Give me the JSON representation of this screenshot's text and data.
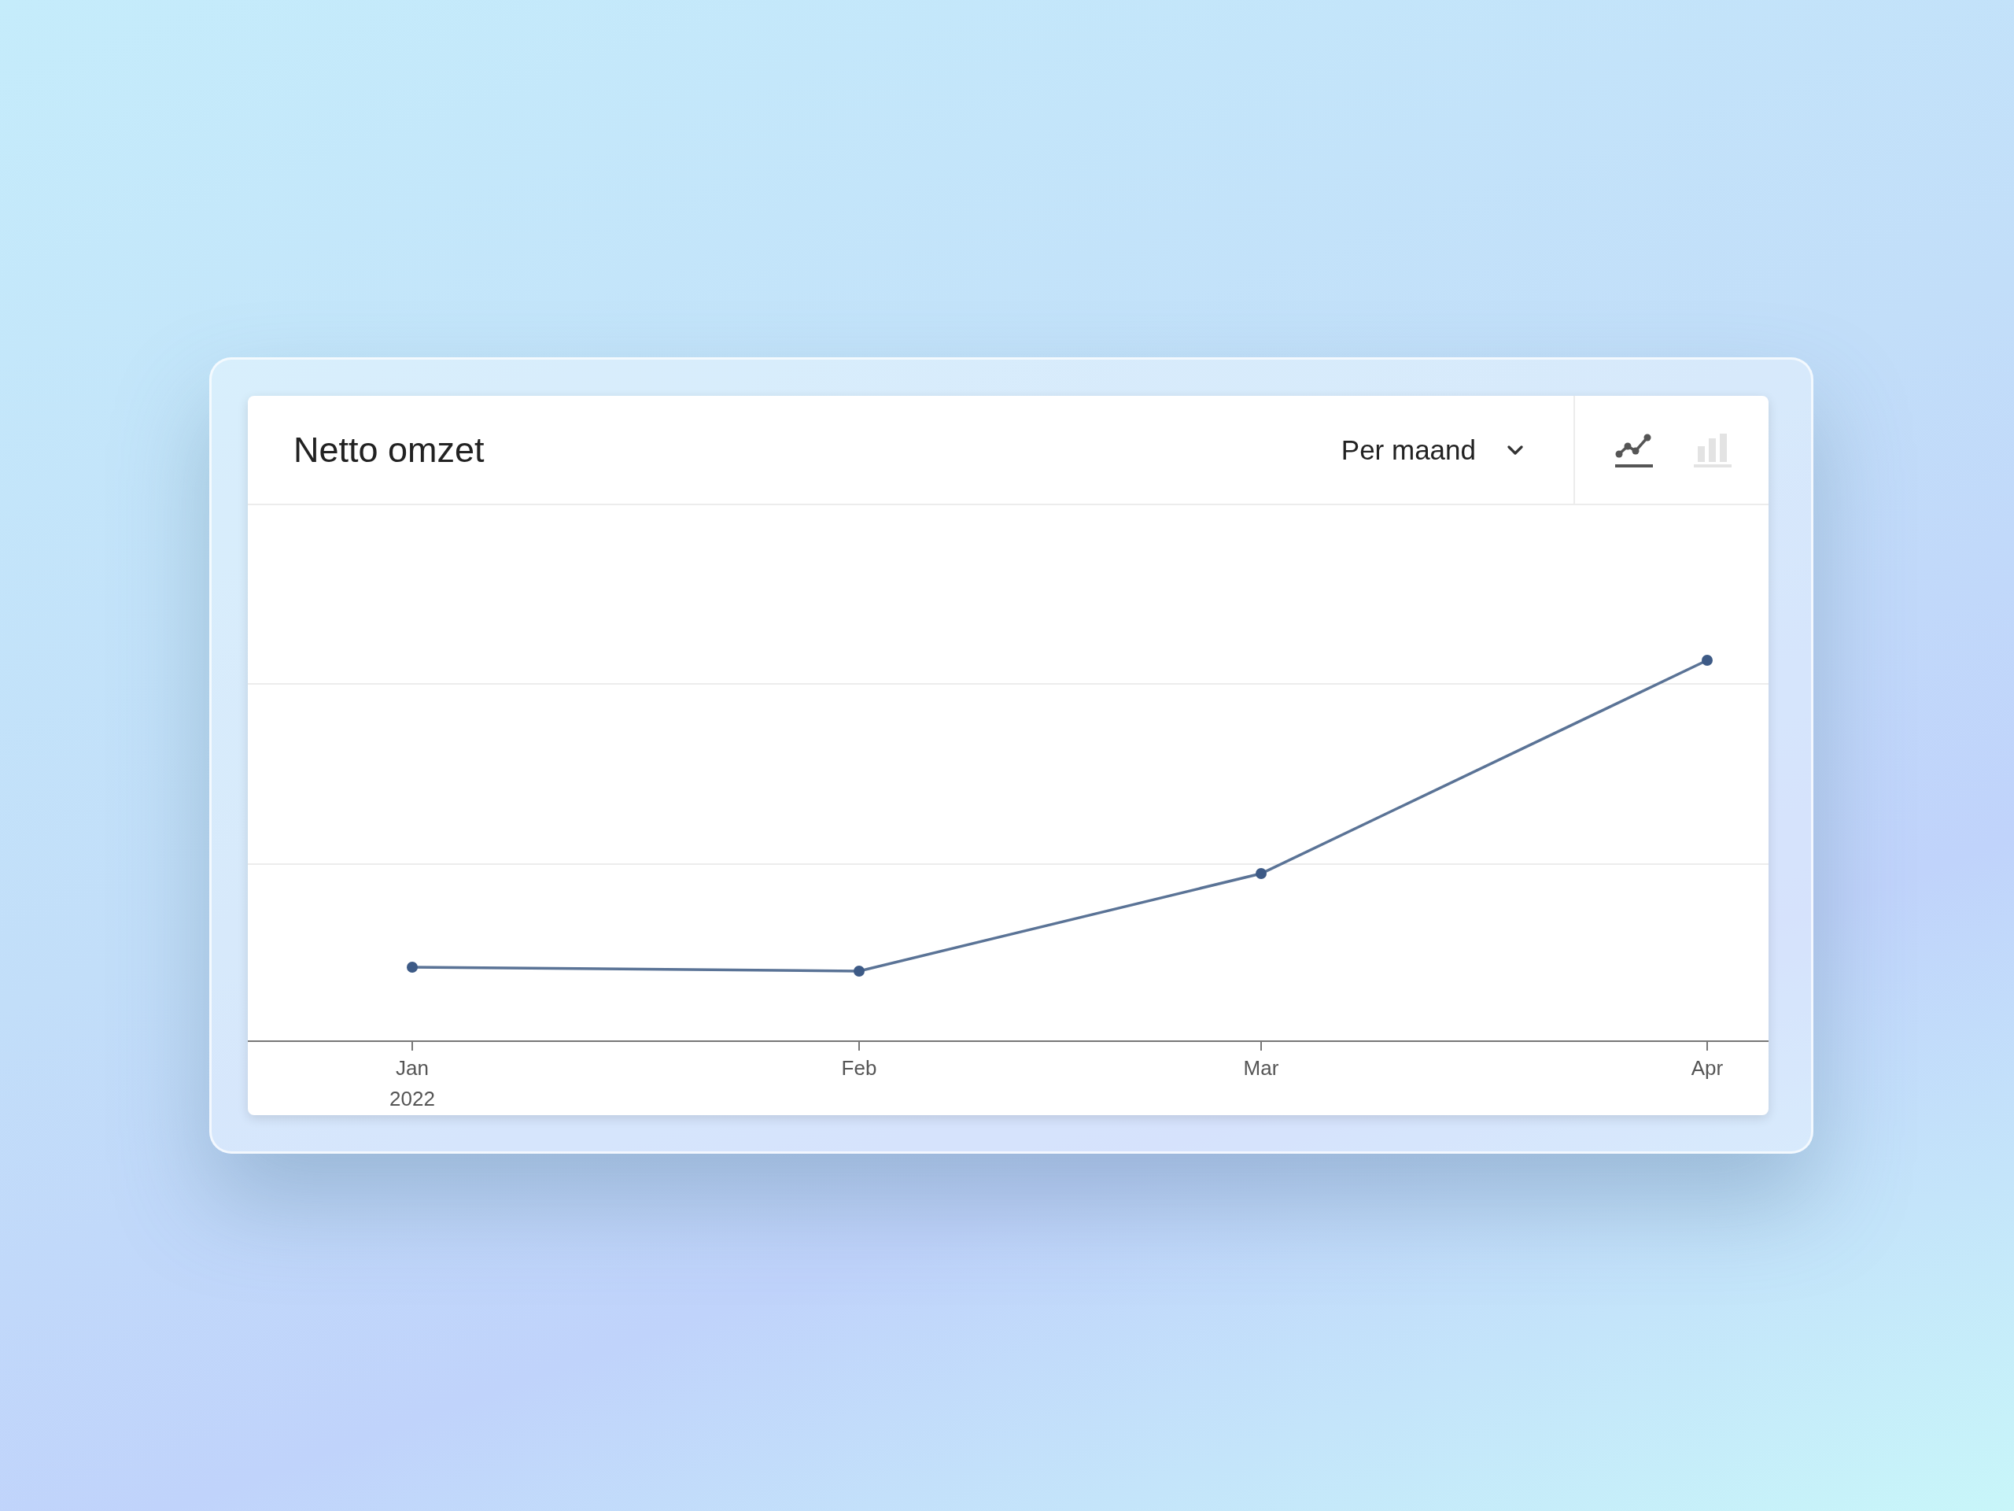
{
  "card": {
    "title": "Netto omzet",
    "period_select": {
      "value": "Per maand"
    },
    "chart_toggles": [
      {
        "kind": "line",
        "selected": true
      },
      {
        "kind": "bar",
        "selected": false
      }
    ],
    "chart": {
      "x_labels": [
        {
          "label": "Jan",
          "sublabel": "2022"
        },
        {
          "label": "Feb"
        },
        {
          "label": "Mar"
        },
        {
          "label": "Apr"
        }
      ]
    }
  }
}
